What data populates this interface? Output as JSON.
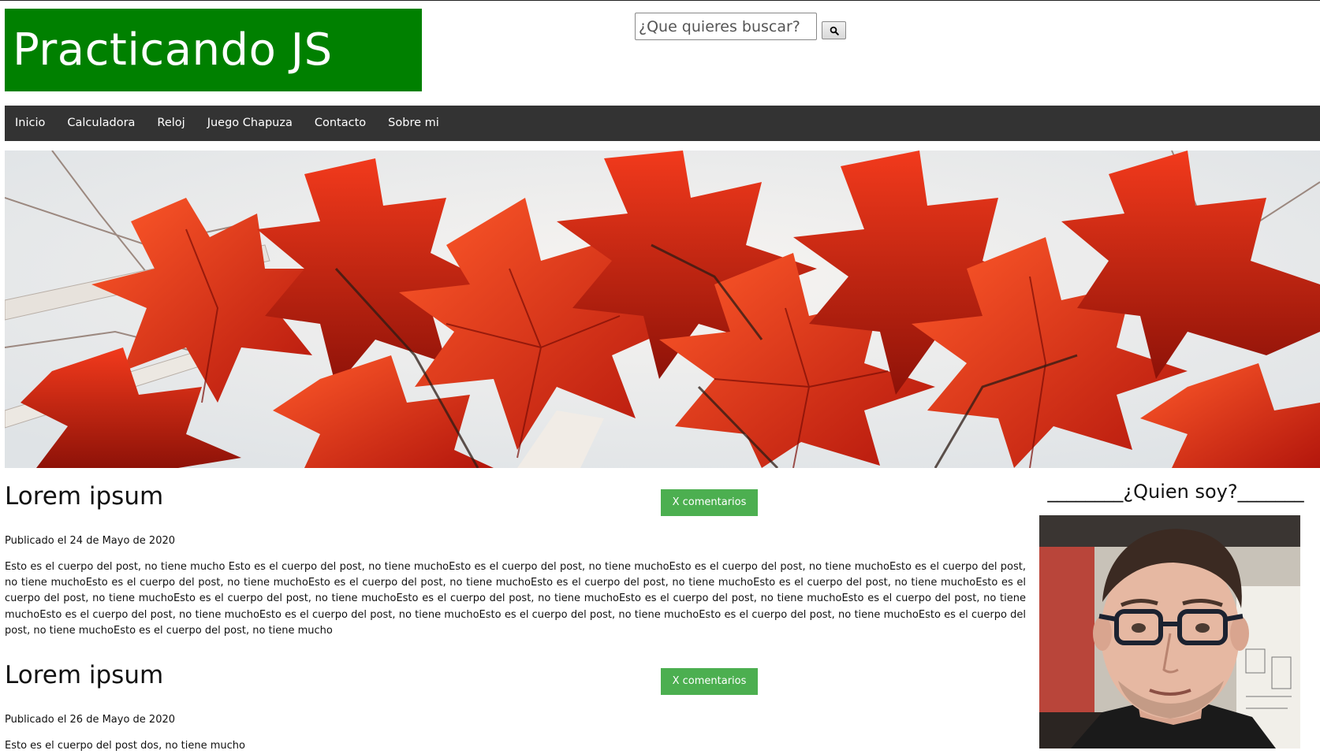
{
  "header": {
    "site_title": "Practicando JS",
    "brand_color": "#008000"
  },
  "search": {
    "placeholder": "¿Que quieres buscar?",
    "button_icon": "search-icon"
  },
  "nav": {
    "items": [
      {
        "label": "Inicio"
      },
      {
        "label": "Calculadora"
      },
      {
        "label": "Reloj"
      },
      {
        "label": "Juego Chapuza"
      },
      {
        "label": "Contacto"
      },
      {
        "label": "Sobre mi"
      }
    ],
    "background": "#333333"
  },
  "hero": {
    "subject": "red autumn maple leaves against a pale sky"
  },
  "posts": [
    {
      "title": "Lorem ipsum",
      "comments_label": "X comentarios",
      "date": "Publicado el 24 de Mayo de 2020",
      "body": "Esto es el cuerpo del post, no tiene mucho Esto es el cuerpo del post, no tiene muchoEsto es el cuerpo del post, no tiene muchoEsto es el cuerpo del post, no tiene muchoEsto es el cuerpo del post, no tiene muchoEsto es el cuerpo del post, no tiene muchoEsto es el cuerpo del post, no tiene muchoEsto es el cuerpo del post, no tiene muchoEsto es el cuerpo del post, no tiene muchoEsto es el cuerpo del post, no tiene muchoEsto es el cuerpo del post, no tiene muchoEsto es el cuerpo del post, no tiene muchoEsto es el cuerpo del post, no tiene muchoEsto es el cuerpo del post, no tiene muchoEsto es el cuerpo del post, no tiene muchoEsto es el cuerpo del post, no tiene muchoEsto es el cuerpo del post, no tiene muchoEsto es el cuerpo del post, no tiene muchoEsto es el cuerpo del post, no tiene muchoEsto es el cuerpo del post, no tiene mucho"
    },
    {
      "title": "Lorem ipsum",
      "comments_label": "X comentarios",
      "date": "Publicado el 26 de Mayo de 2020",
      "body": "Esto es el cuerpo del post dos, no tiene mucho"
    }
  ],
  "comments_button_color": "#4caf50",
  "aside": {
    "title": "________¿Quien soy?_______",
    "avatar_subject": "selfie of a young man with glasses"
  }
}
